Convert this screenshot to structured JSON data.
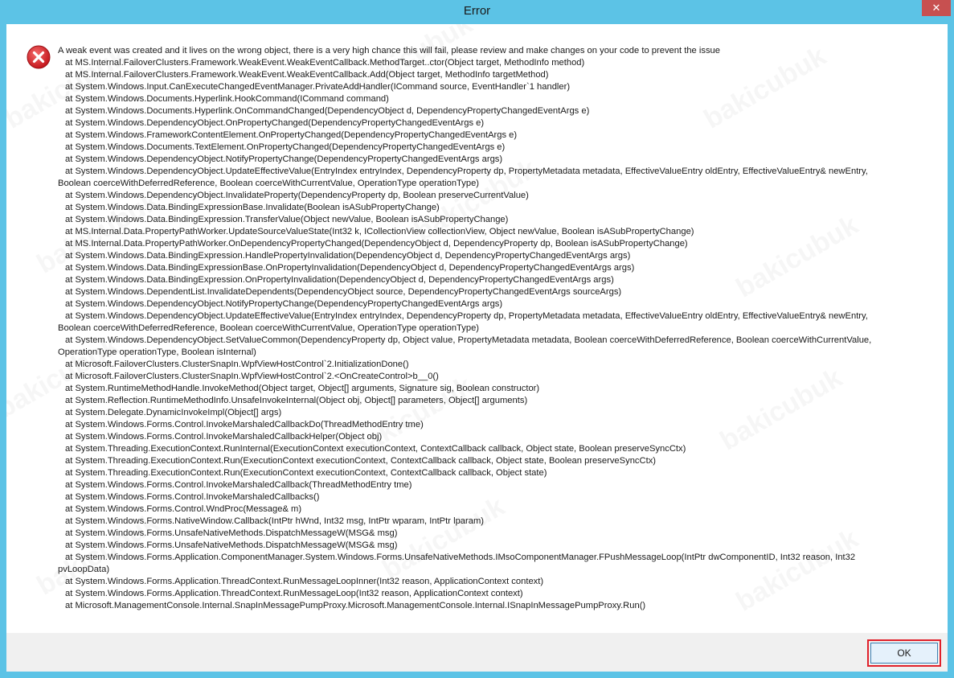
{
  "window": {
    "title": "Error",
    "close_label": "✕"
  },
  "watermark": "bakicubuk",
  "message": [
    {
      "text": "A weak event was created and it lives on the wrong object, there is a very high chance this will fail, please review and make changes on your code to prevent the issue",
      "indent": false
    },
    {
      "text": "at MS.Internal.FailoverClusters.Framework.WeakEvent.WeakEventCallback.MethodTarget..ctor(Object target, MethodInfo method)",
      "indent": true
    },
    {
      "text": "at MS.Internal.FailoverClusters.Framework.WeakEvent.WeakEventCallback.Add(Object target, MethodInfo targetMethod)",
      "indent": true
    },
    {
      "text": "at System.Windows.Input.CanExecuteChangedEventManager.PrivateAddHandler(ICommand source, EventHandler`1 handler)",
      "indent": true
    },
    {
      "text": "at System.Windows.Documents.Hyperlink.HookCommand(ICommand command)",
      "indent": true
    },
    {
      "text": "at System.Windows.Documents.Hyperlink.OnCommandChanged(DependencyObject d, DependencyPropertyChangedEventArgs e)",
      "indent": true
    },
    {
      "text": "at System.Windows.DependencyObject.OnPropertyChanged(DependencyPropertyChangedEventArgs e)",
      "indent": true
    },
    {
      "text": "at System.Windows.FrameworkContentElement.OnPropertyChanged(DependencyPropertyChangedEventArgs e)",
      "indent": true
    },
    {
      "text": "at System.Windows.Documents.TextElement.OnPropertyChanged(DependencyPropertyChangedEventArgs e)",
      "indent": true
    },
    {
      "text": "at System.Windows.DependencyObject.NotifyPropertyChange(DependencyPropertyChangedEventArgs args)",
      "indent": true
    },
    {
      "text": "at System.Windows.DependencyObject.UpdateEffectiveValue(EntryIndex entryIndex, DependencyProperty dp, PropertyMetadata metadata, EffectiveValueEntry oldEntry, EffectiveValueEntry& newEntry,",
      "indent": true
    },
    {
      "text": "Boolean coerceWithDeferredReference, Boolean coerceWithCurrentValue, OperationType operationType)",
      "indent": false
    },
    {
      "text": "at System.Windows.DependencyObject.InvalidateProperty(DependencyProperty dp, Boolean preserveCurrentValue)",
      "indent": true
    },
    {
      "text": "at System.Windows.Data.BindingExpressionBase.Invalidate(Boolean isASubPropertyChange)",
      "indent": true
    },
    {
      "text": "at System.Windows.Data.BindingExpression.TransferValue(Object newValue, Boolean isASubPropertyChange)",
      "indent": true
    },
    {
      "text": "at MS.Internal.Data.PropertyPathWorker.UpdateSourceValueState(Int32 k, ICollectionView collectionView, Object newValue, Boolean isASubPropertyChange)",
      "indent": true
    },
    {
      "text": "at MS.Internal.Data.PropertyPathWorker.OnDependencyPropertyChanged(DependencyObject d, DependencyProperty dp, Boolean isASubPropertyChange)",
      "indent": true
    },
    {
      "text": "at System.Windows.Data.BindingExpression.HandlePropertyInvalidation(DependencyObject d, DependencyPropertyChangedEventArgs args)",
      "indent": true
    },
    {
      "text": "at System.Windows.Data.BindingExpressionBase.OnPropertyInvalidation(DependencyObject d, DependencyPropertyChangedEventArgs args)",
      "indent": true
    },
    {
      "text": "at System.Windows.Data.BindingExpression.OnPropertyInvalidation(DependencyObject d, DependencyPropertyChangedEventArgs args)",
      "indent": true
    },
    {
      "text": "at System.Windows.DependentList.InvalidateDependents(DependencyObject source, DependencyPropertyChangedEventArgs sourceArgs)",
      "indent": true
    },
    {
      "text": "at System.Windows.DependencyObject.NotifyPropertyChange(DependencyPropertyChangedEventArgs args)",
      "indent": true
    },
    {
      "text": "at System.Windows.DependencyObject.UpdateEffectiveValue(EntryIndex entryIndex, DependencyProperty dp, PropertyMetadata metadata, EffectiveValueEntry oldEntry, EffectiveValueEntry& newEntry,",
      "indent": true
    },
    {
      "text": "Boolean coerceWithDeferredReference, Boolean coerceWithCurrentValue, OperationType operationType)",
      "indent": false
    },
    {
      "text": "at System.Windows.DependencyObject.SetValueCommon(DependencyProperty dp, Object value, PropertyMetadata metadata, Boolean coerceWithDeferredReference, Boolean coerceWithCurrentValue,",
      "indent": true
    },
    {
      "text": "OperationType operationType, Boolean isInternal)",
      "indent": false
    },
    {
      "text": "at Microsoft.FailoverClusters.ClusterSnapIn.WpfViewHostControl`2.InitializationDone()",
      "indent": true
    },
    {
      "text": "at Microsoft.FailoverClusters.ClusterSnapIn.WpfViewHostControl`2.<OnCreateControl>b__0()",
      "indent": true
    },
    {
      "text": "at System.RuntimeMethodHandle.InvokeMethod(Object target, Object[] arguments, Signature sig, Boolean constructor)",
      "indent": true
    },
    {
      "text": "at System.Reflection.RuntimeMethodInfo.UnsafeInvokeInternal(Object obj, Object[] parameters, Object[] arguments)",
      "indent": true
    },
    {
      "text": "at System.Delegate.DynamicInvokeImpl(Object[] args)",
      "indent": true
    },
    {
      "text": "at System.Windows.Forms.Control.InvokeMarshaledCallbackDo(ThreadMethodEntry tme)",
      "indent": true
    },
    {
      "text": "at System.Windows.Forms.Control.InvokeMarshaledCallbackHelper(Object obj)",
      "indent": true
    },
    {
      "text": "at System.Threading.ExecutionContext.RunInternal(ExecutionContext executionContext, ContextCallback callback, Object state, Boolean preserveSyncCtx)",
      "indent": true
    },
    {
      "text": "at System.Threading.ExecutionContext.Run(ExecutionContext executionContext, ContextCallback callback, Object state, Boolean preserveSyncCtx)",
      "indent": true
    },
    {
      "text": "at System.Threading.ExecutionContext.Run(ExecutionContext executionContext, ContextCallback callback, Object state)",
      "indent": true
    },
    {
      "text": "at System.Windows.Forms.Control.InvokeMarshaledCallback(ThreadMethodEntry tme)",
      "indent": true
    },
    {
      "text": "at System.Windows.Forms.Control.InvokeMarshaledCallbacks()",
      "indent": true
    },
    {
      "text": "at System.Windows.Forms.Control.WndProc(Message& m)",
      "indent": true
    },
    {
      "text": "at System.Windows.Forms.NativeWindow.Callback(IntPtr hWnd, Int32 msg, IntPtr wparam, IntPtr lparam)",
      "indent": true
    },
    {
      "text": "at System.Windows.Forms.UnsafeNativeMethods.DispatchMessageW(MSG& msg)",
      "indent": true
    },
    {
      "text": "at System.Windows.Forms.UnsafeNativeMethods.DispatchMessageW(MSG& msg)",
      "indent": true
    },
    {
      "text": "at System.Windows.Forms.Application.ComponentManager.System.Windows.Forms.UnsafeNativeMethods.IMsoComponentManager.FPushMessageLoop(IntPtr dwComponentID, Int32 reason, Int32",
      "indent": true
    },
    {
      "text": "pvLoopData)",
      "indent": false
    },
    {
      "text": "at System.Windows.Forms.Application.ThreadContext.RunMessageLoopInner(Int32 reason, ApplicationContext context)",
      "indent": true
    },
    {
      "text": "at System.Windows.Forms.Application.ThreadContext.RunMessageLoop(Int32 reason, ApplicationContext context)",
      "indent": true
    },
    {
      "text": "at Microsoft.ManagementConsole.Internal.SnapInMessagePumpProxy.Microsoft.ManagementConsole.Internal.ISnapInMessagePumpProxy.Run()",
      "indent": true
    }
  ],
  "footer": {
    "ok_label": "OK"
  },
  "colors": {
    "titlebar": "#5cc3e6",
    "close_button": "#c75050",
    "highlight": "#e0202a",
    "error_icon": "#d0202a"
  }
}
